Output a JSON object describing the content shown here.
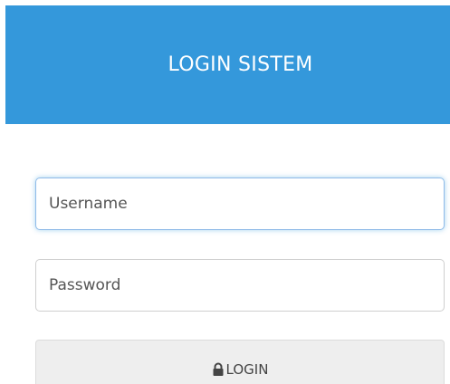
{
  "header": {
    "title": "LOGIN SISTEM"
  },
  "form": {
    "username_placeholder": "Username",
    "password_placeholder": "Password",
    "login_label": "LOGIN",
    "login_icon": "lock-icon"
  },
  "colors": {
    "header_bg": "#3498db",
    "header_text": "#ffffff",
    "button_bg": "#eeeeee",
    "focus_border": "#8fbbe8"
  }
}
